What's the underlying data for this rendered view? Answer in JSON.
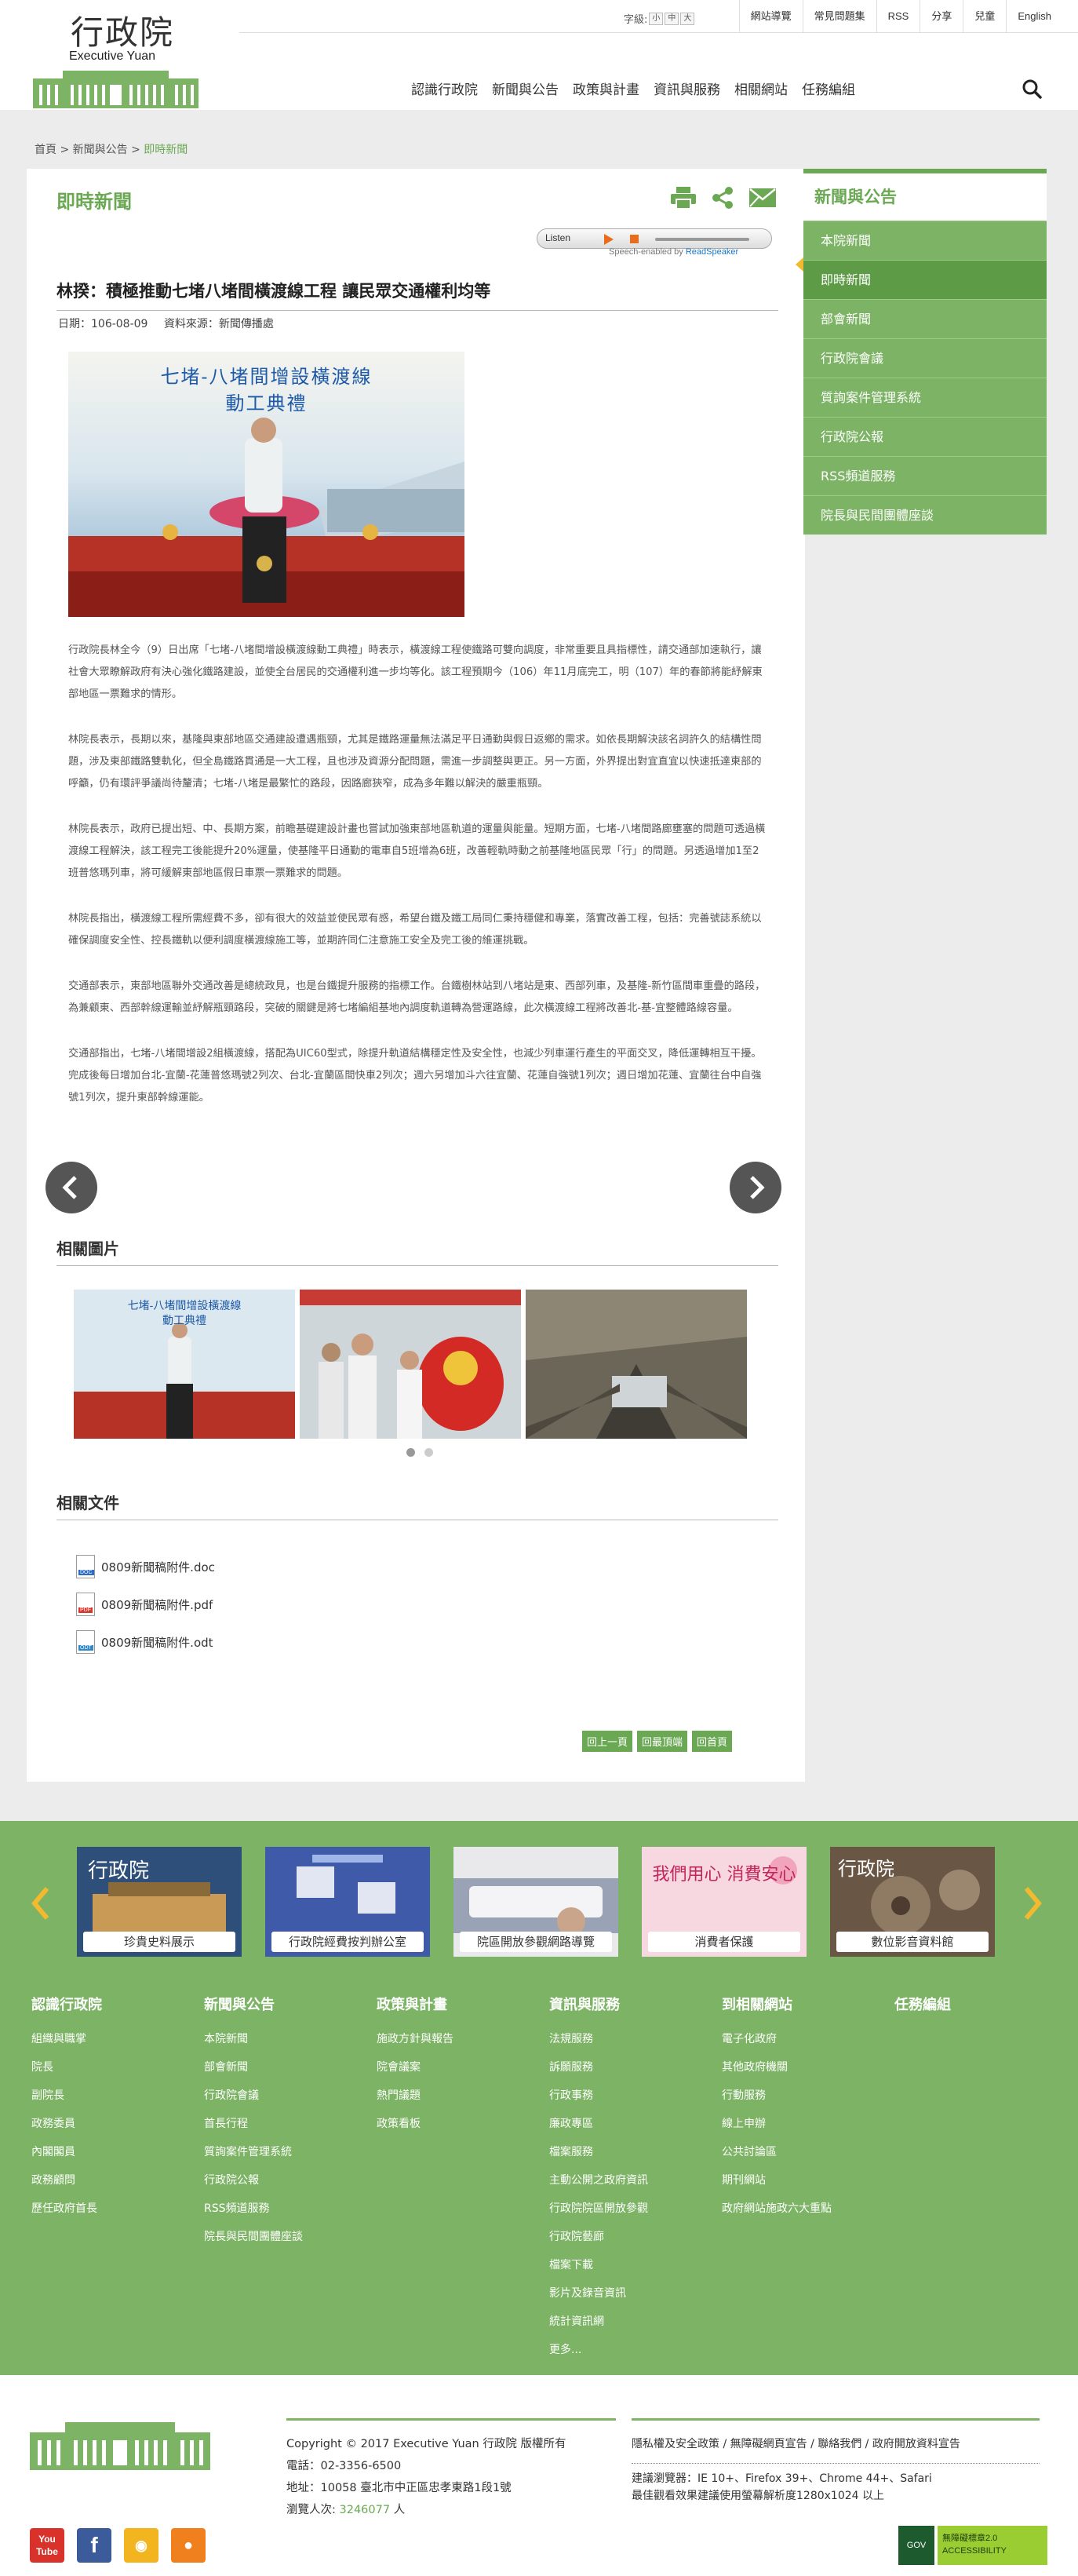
{
  "header": {
    "logo_cn": "行政院",
    "logo_en": "Executive Yuan",
    "fontsize_label": "字級:",
    "fontsize_options": [
      "小",
      "中",
      "大"
    ],
    "top_links": [
      "網站導覽",
      "常見問題集",
      "RSS",
      "分享",
      "兒童",
      "English"
    ],
    "main_nav": [
      "認識行政院",
      "新聞與公告",
      "政策與計畫",
      "資訊與服務",
      "相關網站",
      "任務編組"
    ]
  },
  "breadcrumb": [
    "首頁",
    "新聞與公告",
    "即時新聞"
  ],
  "page": {
    "title": "即時新聞",
    "listen_label": "Listen",
    "speech_enabled_prefix": "Speech-enabled by",
    "speech_enabled_brand": "ReadSpeaker",
    "article_title": "林揆：積極推動七堵八堵間橫渡線工程 讓民眾交通權利均等",
    "date_label": "日期：106-08-09",
    "source_label": "資料來源：新聞傳播處",
    "photo_banner_line1": "七堵-八堵間增設橫渡線",
    "photo_banner_line2": "動工典禮",
    "paragraphs": [
      "行政院長林全今（9）日出席「七堵-八堵間增設橫渡線動工典禮」時表示，橫渡線工程使鐵路可雙向調度，非常重要且具指標性，請交通部加速執行，讓社會大眾瞭解政府有決心強化鐵路建設，並使全台居民的交通權利進一步均等化。該工程預期今（106）年11月底完工，明（107）年的春節將能紓解東部地區一票難求的情形。",
      "林院長表示，長期以來，基隆與東部地區交通建設遭遇瓶頸，尤其是鐵路運量無法滿足平日通勤與假日返鄉的需求。如依長期解決該名詞許久的結構性問題，涉及東部鐵路雙軌化，但全島鐵路貫通是一大工程，且也涉及資源分配問題，需進一步調整與更正。另一方面，外界提出對宜直宜以快速抵達東部的呼籲，仍有環評爭議尚待釐清；七堵-八堵是最繁忙的路段，因路廊狹窄，成為多年難以解決的嚴重瓶頸。",
      "林院長表示，政府已提出短、中、長期方案，前瞻基礎建設計畫也嘗試加強東部地區軌道的運量與能量。短期方面，七堵-八堵間路廊壅塞的問題可透過橫渡線工程解決，該工程完工後能提升20%運量，使基隆平日通勤的電車自5班增為6班，改善輕軌時動之前基隆地區民眾「行」的問題。另透過增加1至2班普悠瑪列車，將可緩解東部地區假日車票一票難求的問題。",
      "林院長指出，橫渡線工程所需經費不多，卻有很大的效益並使民眾有感，希望台鐵及鐵工局同仁秉持穩健和專業，落實改善工程，包括：完善號誌系統以確保調度安全性、控長鐵軌以便利調度橫渡線施工等，並期許同仁注意施工安全及完工後的維運挑戰。",
      "交通部表示，東部地區聯外交通改善是總統政見，也是台鐵提升服務的指標工作。台鐵樹林站到八堵站是東、西部列車，及基隆-新竹區間車重疊的路段，為兼顧東、西部幹線運輸並紓解瓶頸路段，突破的關鍵是將七堵編組基地內調度軌道轉為營運路線，此次橫渡線工程將改善北-基-宜整體路線容量。",
      "交通部指出，七堵-八堵間增設2組橫渡線，搭配為UIC60型式，除提升軌道結構穩定性及安全性，也減少列車運行產生的平面交叉，降低運轉相互干擾。完成後每日增加台北-宜蘭-花蓮普悠瑪號2列次、台北-宜蘭區間快車2列次；週六另增加斗六往宜蘭、花蓮自強號1列次；週日增加花蓮、宜蘭往台中自強號1列次，提升東部幹線運能。"
    ],
    "related_photos_title": "相關圖片",
    "related_files_title": "相關文件",
    "files": [
      {
        "name": "0809新聞稿附件.doc",
        "type": "DOC",
        "color": "#2b6cc4"
      },
      {
        "name": "0809新聞稿附件.pdf",
        "type": "PDF",
        "color": "#d9352b"
      },
      {
        "name": "0809新聞稿附件.odt",
        "type": "ODT",
        "color": "#2f88c9"
      }
    ],
    "nav_buttons": [
      "回上一頁",
      "回最頂端",
      "回首頁"
    ]
  },
  "sidenav": {
    "title": "新聞與公告",
    "items": [
      "本院新聞",
      "即時新聞",
      "部會新聞",
      "行政院會議",
      "質詢案件管理系統",
      "行政院公報",
      "RSS頻道服務",
      "院長與民間團體座談"
    ],
    "active_index": 1
  },
  "banners": [
    {
      "caption": "珍貴史料展示",
      "logo": "行政院"
    },
    {
      "caption": "行政院經費按判辦公室",
      "logo": ""
    },
    {
      "caption": "院區開放參觀網路導覽",
      "logo": ""
    },
    {
      "caption": "消費者保護",
      "logo": "我們用心 消費安心"
    },
    {
      "caption": "數位影音資料館",
      "logo": "行政院"
    }
  ],
  "footer_columns": [
    {
      "title": "認識行政院",
      "links": [
        "組織與職掌",
        "院長",
        "副院長",
        "政務委員",
        "內閣閣員",
        "政務顧問",
        "歷任政府首長"
      ]
    },
    {
      "title": "新聞與公告",
      "links": [
        "本院新聞",
        "部會新聞",
        "行政院會議",
        "首長行程",
        "質詢案件管理系統",
        "行政院公報",
        "RSS頻道服務",
        "院長與民間團體座談"
      ]
    },
    {
      "title": "政策與計畫",
      "links": [
        "施政方針與報告",
        "院會議案",
        "熱門議題",
        "政策看板"
      ]
    },
    {
      "title": "資訊與服務",
      "links": [
        "法規服務",
        "訴願服務",
        "行政事務",
        "廉政專區",
        "檔案服務",
        "主動公開之政府資訊",
        "行政院院區開放參觀",
        "行政院藝廊",
        "檔案下載",
        "影片及錄音資訊",
        "統計資訊網",
        "更多..."
      ]
    },
    {
      "title": "到相關網站",
      "links": [
        "電子化政府",
        "其他政府機關",
        "行動服務",
        "線上申辦",
        "公共討論區",
        "期刊網站",
        "政府網站施政六大重點"
      ]
    },
    {
      "title": "任務編組",
      "links": []
    }
  ],
  "bottom": {
    "copyright": "Copyright © 2017 Executive Yuan 行政院 版權所有",
    "phone": "電話：02-3356-6500",
    "address": "地址：10058 臺北市中正區忠孝東路1段1號",
    "visitors_label": "瀏覽人次:",
    "visitors_count": "3246077",
    "visitors_unit": "人",
    "policy_links": "隱私權及安全政策 / 無障礙網頁宣告 / 聯絡我們 / 政府開放資料宣告",
    "browser_line1": "建議瀏覽器：IE 10+、Firefox 39+、Chrome 44+、Safari",
    "browser_line2": "最佳觀看效果建議使用螢幕解析度1280x1024 以上",
    "social": [
      "YouTube",
      "Facebook",
      "Flickr",
      "RSS"
    ],
    "acc_badge": "無障礙標章2.0 ACCESSIBILITY",
    "gov_badge": "GOV"
  },
  "colors": {
    "accent": "#6aa853",
    "side_green": "#7cb364",
    "footer_green": "#7cb364",
    "pointer": "#f3ba2f"
  }
}
